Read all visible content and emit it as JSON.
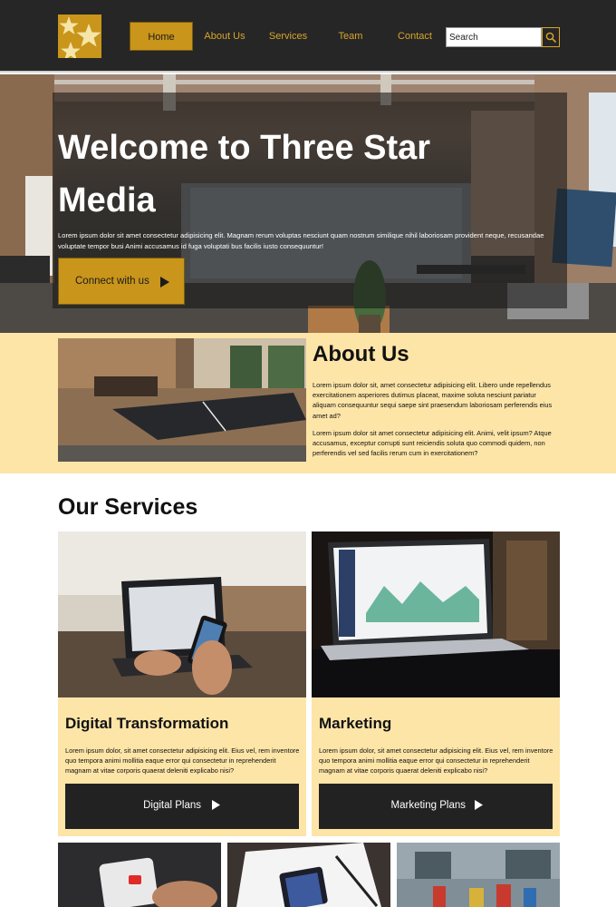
{
  "header": {
    "logo": "three-star-logo",
    "nav": [
      {
        "label": "Home",
        "active": true
      },
      {
        "label": "About Us",
        "active": false
      },
      {
        "label": "Services",
        "active": false
      },
      {
        "label": "Team",
        "active": false
      },
      {
        "label": "Contact",
        "active": false
      }
    ],
    "search": {
      "placeholder": "Search",
      "value": "Search",
      "icon": "search-icon"
    }
  },
  "hero": {
    "title": "Welcome to Three Star Media",
    "text": "Lorem ipsum dolor sit amet consectetur adipisicing elit. Magnam rerum voluptas nesciunt quam nostrum similique nihil laboriosam provident neque, recusandae voluptate tempor busi Animi accusamus id fuga voluptati bus facilis iusto consequuntur!",
    "cta": {
      "label": "Connect with us",
      "icon": "play-arrow-icon"
    }
  },
  "about": {
    "title": "About Us",
    "paragraphs": [
      "Lorem ipsum dolor sit, amet consectetur adipisicing elit. Libero unde repellendus exercitationem asperiores dutimus placeat, maxime soluta nesciunt pariatur aliquam consequuntur sequi saepe sint praesendum laboriosam perferendis eius amet ad?",
      "Lorem ipsum dolor sit amet consectetur adipisicing elit. Animi, velit ipsum? Atque accusamus, exceptur corrupti sunt reiciendis soluta quo commodi quidem, non perferendis vel sed facilis rerum cum in exercitationem?"
    ]
  },
  "services": {
    "title": "Our Services",
    "cards": [
      {
        "title": "Digital Transformation",
        "text": "Lorem ipsum dolor, sit amet consectetur adipisicing elit. Eius vel, rem inventore quo tempora animi mollitia eaque error qui consectetur in reprehenderit magnam at vitae corporis quaerat deleniti explicabo nisi?",
        "button": "Digital Plans"
      },
      {
        "title": "Marketing",
        "text": "Lorem ipsum dolor, sit amet consectetur adipisicing elit. Eius vel, rem inventore quo tempora animi mollitia eaque error qui consectetur in reprehenderit magnam at vitae corporis quaerat deleniti explicabo nisi?",
        "button": "Marketing Plans"
      }
    ]
  },
  "colors": {
    "header_bg": "#262626",
    "accent_gold": "#c9951a",
    "nav_text": "#d9a52c",
    "section_bg": "#fde5a8",
    "button_dark": "#222222"
  }
}
